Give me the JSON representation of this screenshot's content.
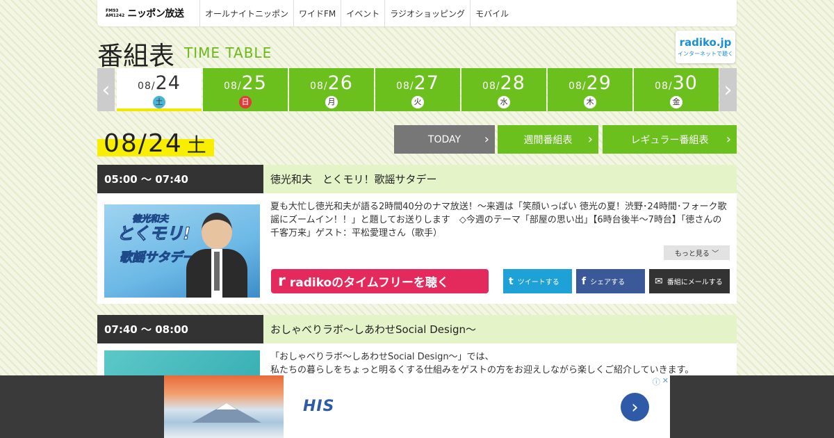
{
  "nav": {
    "logo_freq_top": "FM93",
    "logo_freq_bottom": "AM1242",
    "logo_name": "ニッポン放送",
    "links": [
      "オールナイトニッポン",
      "ワイドFM",
      "イベント",
      "ラジオショッピング",
      "モバイル"
    ]
  },
  "page": {
    "title_ja": "番組表",
    "title_en": "TIME TABLE"
  },
  "radiko_badge": {
    "name": "radiko.jp",
    "tagline": "インターネットで聴く"
  },
  "days": [
    {
      "month": "08/",
      "day": "24",
      "weekday": "土"
    },
    {
      "month": "08/",
      "day": "25",
      "weekday": "日"
    },
    {
      "month": "08/",
      "day": "26",
      "weekday": "月"
    },
    {
      "month": "08/",
      "day": "27",
      "weekday": "火"
    },
    {
      "month": "08/",
      "day": "28",
      "weekday": "水"
    },
    {
      "month": "08/",
      "day": "29",
      "weekday": "木"
    },
    {
      "month": "08/",
      "day": "30",
      "weekday": "金"
    }
  ],
  "arrows": {
    "prev": "‹",
    "next": "›"
  },
  "current_date": {
    "date": "08/24",
    "weekday": "土"
  },
  "buttons": {
    "today": "TODAY",
    "weekly": "週間番組表",
    "regular": "レギュラー番組表",
    "chevron": "›"
  },
  "programs": [
    {
      "time": "05:00 ～ 07:40",
      "title": "徳光和夫　とくモリ！歌謡サタデー",
      "description": "夏も大忙し徳光和夫が語る2時間40分のナマ放送！～来週は「笑顔いっぱい 徳光の夏！渋野･24時間･フォーク歌謡にズームイン！！」と題してお送りします　◇今週のテーマ「部屋の思い出」【6時台後半～7時台】「徳さんの千客万来」ゲスト：平松愛理さん（歌手）",
      "thumb_text": [
        "徳光和夫",
        "とくモリ!",
        "歌謡サタデー"
      ],
      "more_label": "もっと見る ﹀",
      "radiko_icon": "r",
      "radiko_label": "radikoのタイムフリーを聴く",
      "tweet_icon": "t",
      "tweet_label": "ツイートする",
      "share_icon": "f",
      "share_label": "シェアする",
      "mail_icon": "✉",
      "mail_label": "番組にメールする"
    },
    {
      "time": "07:40 ～ 08:00",
      "title": "おしゃべりラボ～しあわせSocial Design～",
      "description_lines": [
        "「おしゃべりラボ～しあわせSocial Design～」では、",
        "私たちの暮らしをちょっと明るくする仕組みをゲストの方をお迎えしながら楽しくご紹介していきます。"
      ]
    }
  ],
  "ad": {
    "brand": "HIS",
    "go": "›",
    "controls": [
      "ⓘ",
      "✕"
    ]
  },
  "colors": {
    "green": "#6cc01e",
    "yellow": "#f8ee00",
    "radiko_pink": "#e42a5c",
    "twitter": "#1da1d6",
    "facebook": "#3b5998"
  }
}
